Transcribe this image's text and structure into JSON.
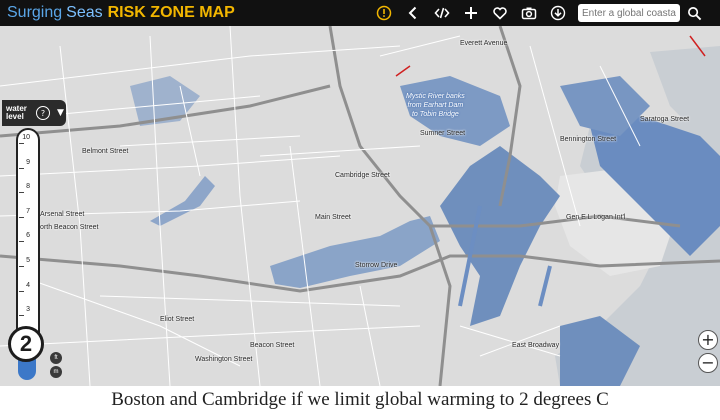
{
  "header": {
    "brand_part1": "Surging",
    "brand_part2": "Seas",
    "brand_part3": "RISK ZONE MAP",
    "colors": {
      "brand_blue": "#5aa6e8",
      "brand_yellow": "#f2b600",
      "bar": "#111111"
    }
  },
  "toolbar": {
    "icons": [
      "info-icon",
      "share-icon",
      "embed-icon",
      "plus-icon",
      "heart-icon",
      "camera-icon",
      "download-icon"
    ]
  },
  "search": {
    "placeholder": "Enter a global coastal pl",
    "icon": "search-icon"
  },
  "map": {
    "colors": {
      "land": "#dcdcdc",
      "water": "#c9ced3",
      "flood": "#6f8fbd",
      "road": "#ffffff",
      "highway": "#9a9a9a"
    },
    "place_labels": [
      "Arsenal Street",
      "North Beacon Street",
      "Belmont Street",
      "Cambridge Street",
      "Main Street",
      "Storrow Drive",
      "Gen E L Logan Int'l",
      "Eliot Street",
      "Everett Avenue",
      "Beacon Street",
      "East Broadway",
      "Sumner Street",
      "Saratoga Street",
      "Washington Street",
      "Bennington Street"
    ],
    "water_annotation": [
      "Mystic River banks",
      "from Earhart Dam",
      "to Tobin Bridge"
    ]
  },
  "water_level": {
    "title_line1": "water",
    "title_line2": "level",
    "help": "?",
    "ticks": [
      "10",
      "9",
      "8",
      "7",
      "6",
      "5",
      "4",
      "3"
    ],
    "current": "2",
    "unit_buttons": [
      "ft",
      "m"
    ],
    "max": 10,
    "fill_color": "#3c78c8"
  },
  "zoom": {
    "in_label": "+",
    "out_label": "−"
  },
  "caption": "Boston and Cambridge if we limit global warming to 2 degrees C"
}
